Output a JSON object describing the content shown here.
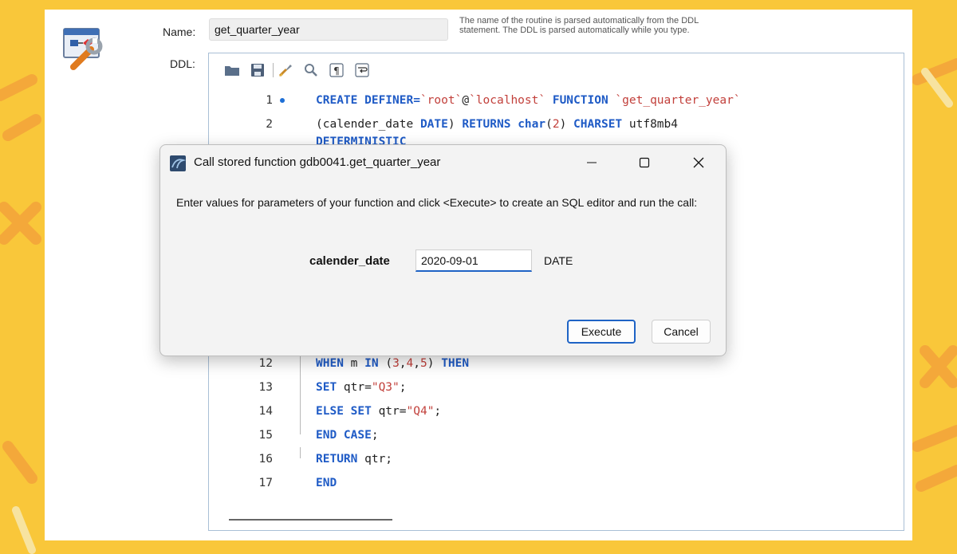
{
  "colors": {
    "background": "#f9c73a",
    "keyword": "#1f5bc6",
    "string": "#c2403b",
    "accent": "#1e63c5"
  },
  "form": {
    "name_label": "Name:",
    "name_value": "get_quarter_year",
    "name_hint_line1": "The name of the routine is parsed automatically from the DDL",
    "name_hint_line2": "statement. The DDL is parsed automatically while you type.",
    "ddl_label": "DDL:"
  },
  "toolbar": {
    "icons": [
      "folder-open-icon",
      "save-icon",
      "beautify-brush-icon",
      "find-icon",
      "show-invisibles-icon",
      "word-wrap-icon"
    ]
  },
  "editor": {
    "lines": [
      {
        "num": "1",
        "tokens": [
          {
            "t": "CREATE DEFINER=",
            "c": "kw"
          },
          {
            "t": "`root`",
            "c": "str"
          },
          {
            "t": "@",
            "c": "plain"
          },
          {
            "t": "`localhost`",
            "c": "str"
          },
          {
            "t": " FUNCTION ",
            "c": "kw"
          },
          {
            "t": "`get_quarter_year`",
            "c": "str"
          }
        ]
      },
      {
        "num": "2",
        "tokens": [
          {
            "t": "(calender_date ",
            "c": "plain"
          },
          {
            "t": "DATE",
            "c": "kw"
          },
          {
            "t": ") ",
            "c": "plain"
          },
          {
            "t": "RETURNS ",
            "c": "kw"
          },
          {
            "t": "char",
            "c": "kw"
          },
          {
            "t": "(",
            "c": "plain"
          },
          {
            "t": "2",
            "c": "num"
          },
          {
            "t": ") ",
            "c": "plain"
          },
          {
            "t": "CHARSET ",
            "c": "kw"
          },
          {
            "t": "utf8mb4",
            "c": "plain"
          }
        ]
      },
      {
        "num": "12",
        "tokens": [
          {
            "t": "WHEN ",
            "c": "kw"
          },
          {
            "t": "m ",
            "c": "plain"
          },
          {
            "t": "IN ",
            "c": "kw"
          },
          {
            "t": "(",
            "c": "plain"
          },
          {
            "t": "3",
            "c": "num"
          },
          {
            "t": ",",
            "c": "plain"
          },
          {
            "t": "4",
            "c": "num"
          },
          {
            "t": ",",
            "c": "plain"
          },
          {
            "t": "5",
            "c": "num"
          },
          {
            "t": ") ",
            "c": "plain"
          },
          {
            "t": "THEN",
            "c": "kw"
          }
        ]
      },
      {
        "num": "13",
        "tokens": [
          {
            "t": "SET ",
            "c": "kw"
          },
          {
            "t": "qtr=",
            "c": "plain"
          },
          {
            "t": "\"Q3\"",
            "c": "str"
          },
          {
            "t": ";",
            "c": "plain"
          }
        ]
      },
      {
        "num": "14",
        "tokens": [
          {
            "t": "ELSE SET ",
            "c": "kw"
          },
          {
            "t": "qtr=",
            "c": "plain"
          },
          {
            "t": "\"Q4\"",
            "c": "str"
          },
          {
            "t": ";",
            "c": "plain"
          }
        ]
      },
      {
        "num": "15",
        "tokens": [
          {
            "t": "END CASE",
            "c": "kw"
          },
          {
            "t": ";",
            "c": "plain"
          }
        ]
      },
      {
        "num": "16",
        "tokens": [
          {
            "t": "RETURN ",
            "c": "kw"
          },
          {
            "t": "qtr;",
            "c": "plain"
          }
        ]
      },
      {
        "num": "17",
        "tokens": [
          {
            "t": "END",
            "c": "kw"
          }
        ]
      }
    ]
  },
  "dialog": {
    "title": "Call stored function gdb0041.get_quarter_year",
    "message": "Enter values for parameters of your function and click <Execute> to create an SQL editor and run the call:",
    "param_name": "calender_date",
    "param_value": "2020-09-01",
    "param_type": "DATE",
    "execute_label": "Execute",
    "cancel_label": "Cancel"
  }
}
